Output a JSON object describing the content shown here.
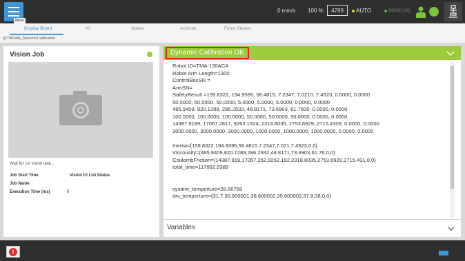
{
  "topbar": {
    "menu_tooltip": "Menu",
    "speed": "0 mm/s",
    "percent": "100 %",
    "counter": "4789",
    "mode_auto": "AUTO",
    "mode_manual": "MANUAL"
  },
  "tabs": [
    {
      "label": "Display Board"
    },
    {
      "label": "IO"
    },
    {
      "label": "Status"
    },
    {
      "label": "Actioner"
    },
    {
      "label": "Force Sensor"
    }
  ],
  "sub_tab": "@TMField_DynamicCalibration",
  "vision_job": {
    "title": "Vision Job",
    "wait_text": "Wait for 1st vision task...",
    "job_start_time_label": "Job Start Time",
    "io_list_status_label": "Vision IO List Status",
    "job_name_label": "Job Name",
    "exec_time_label": "Execution Time (ms)",
    "exec_time_value": "0"
  },
  "calibration": {
    "title": "Dynamic Calibration OK",
    "lines": [
      "Robot ID=TMA-130ACA",
      "Robot Arm Length=1300",
      "ControlBoxSN =",
      "ArmSN=",
      "SafetyResult =159.8322, 194.9395, 58.4815, 7.2347, 7.0210, 7.4523, 0.0000, 0.0000",
      "50.0000, 50.0000, 50.0000, 5.0000, 5.0000, 5.0000, 0.0000, 0.0000",
      "485.9409, 820.1289, 286.2932, 48.8171, 73.6903, 61.7600, 0.0000, 0.0000",
      "100.0000, 100.0000, 100.0000, 50.0000, 50.0000, 50.0000, 0.0000, 0.0000",
      "14387.9189, 17067.2617, 9262.1924, 2318.8035, 2753.6929, 2715.4309, 0.0000, 0.0000",
      "3000.0000, 3000.0000, 3000.0000, 1000.0000, 1000.0000, 1000.0000, 0.0000, 0.0000",
      "",
      "Inertia={159.8322,194.9395,58.4815,7.2347,7.021,7.4523,0,0}",
      "Viscousity={485.9409,820.1289,286.2932,48.8171,73.6903,61.76,0,0}",
      "CoulombFriction={14387.919,17067.262,9262.192,2318.8035,2753.6929,2715.431,0,0}",
      "total_time=117992.9389",
      "",
      "",
      "system_temperture=28.86768",
      "drv_temperture={31.7,30.800001,38.600002,35.600002,37.8,38,0,0}"
    ]
  },
  "variables_label": "Variables"
}
